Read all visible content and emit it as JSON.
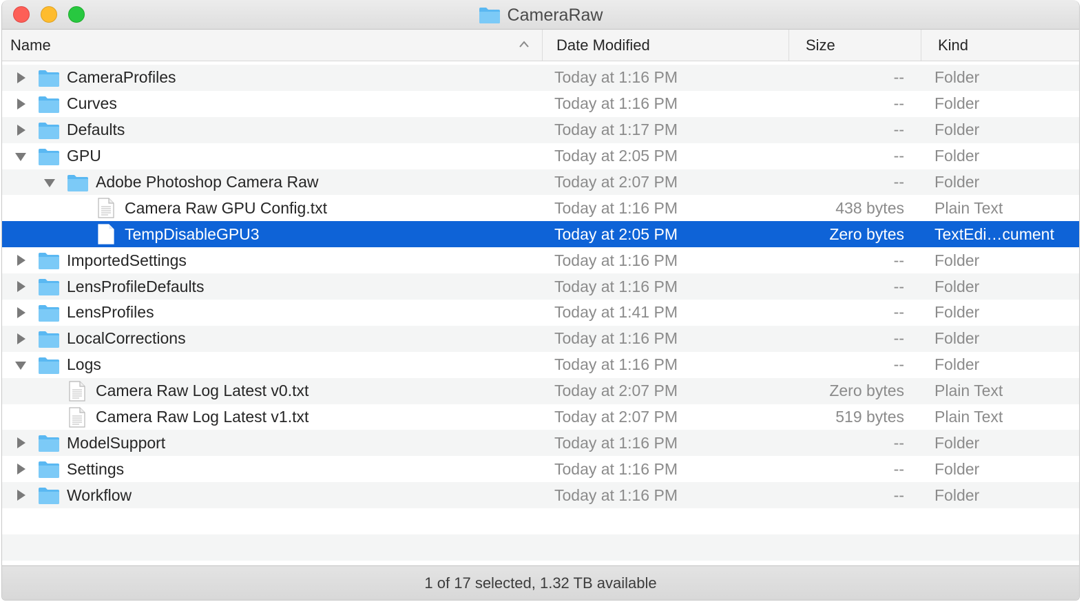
{
  "window": {
    "title": "CameraRaw",
    "title_icon": "folder-icon"
  },
  "columns": {
    "name": "Name",
    "date": "Date Modified",
    "size": "Size",
    "kind": "Kind",
    "sort_indicator": "chevron-up-icon"
  },
  "colors": {
    "selection": "#0e63d7",
    "folder": "#5ab8f2",
    "stripe": "#f4f5f5"
  },
  "rows": [
    {
      "name": "CameraProfiles",
      "date": "Today at 1:16 PM",
      "size": "--",
      "kind": "Folder",
      "type": "folder",
      "depth": 0,
      "disclosure": "collapsed"
    },
    {
      "name": "Curves",
      "date": "Today at 1:16 PM",
      "size": "--",
      "kind": "Folder",
      "type": "folder",
      "depth": 0,
      "disclosure": "collapsed"
    },
    {
      "name": "Defaults",
      "date": "Today at 1:17 PM",
      "size": "--",
      "kind": "Folder",
      "type": "folder",
      "depth": 0,
      "disclosure": "collapsed"
    },
    {
      "name": "GPU",
      "date": "Today at 2:05 PM",
      "size": "--",
      "kind": "Folder",
      "type": "folder",
      "depth": 0,
      "disclosure": "expanded"
    },
    {
      "name": "Adobe Photoshop Camera Raw",
      "date": "Today at 2:07 PM",
      "size": "--",
      "kind": "Folder",
      "type": "folder",
      "depth": 1,
      "disclosure": "expanded"
    },
    {
      "name": "Camera Raw GPU Config.txt",
      "date": "Today at 1:16 PM",
      "size": "438 bytes",
      "kind": "Plain Text",
      "type": "text",
      "depth": 2,
      "disclosure": "none"
    },
    {
      "name": "TempDisableGPU3",
      "date": "Today at 2:05 PM",
      "size": "Zero bytes",
      "kind": "TextEdi…cument",
      "type": "blank",
      "depth": 2,
      "disclosure": "none",
      "selected": true
    },
    {
      "name": "ImportedSettings",
      "date": "Today at 1:16 PM",
      "size": "--",
      "kind": "Folder",
      "type": "folder",
      "depth": 0,
      "disclosure": "collapsed"
    },
    {
      "name": "LensProfileDefaults",
      "date": "Today at 1:16 PM",
      "size": "--",
      "kind": "Folder",
      "type": "folder",
      "depth": 0,
      "disclosure": "collapsed"
    },
    {
      "name": "LensProfiles",
      "date": "Today at 1:41 PM",
      "size": "--",
      "kind": "Folder",
      "type": "folder",
      "depth": 0,
      "disclosure": "collapsed"
    },
    {
      "name": "LocalCorrections",
      "date": "Today at 1:16 PM",
      "size": "--",
      "kind": "Folder",
      "type": "folder",
      "depth": 0,
      "disclosure": "collapsed"
    },
    {
      "name": "Logs",
      "date": "Today at 1:16 PM",
      "size": "--",
      "kind": "Folder",
      "type": "folder",
      "depth": 0,
      "disclosure": "expanded"
    },
    {
      "name": "Camera Raw Log Latest v0.txt",
      "date": "Today at 2:07 PM",
      "size": "Zero bytes",
      "kind": "Plain Text",
      "type": "text",
      "depth": 1,
      "disclosure": "none"
    },
    {
      "name": "Camera Raw Log Latest v1.txt",
      "date": "Today at 2:07 PM",
      "size": "519 bytes",
      "kind": "Plain Text",
      "type": "text",
      "depth": 1,
      "disclosure": "none"
    },
    {
      "name": "ModelSupport",
      "date": "Today at 1:16 PM",
      "size": "--",
      "kind": "Folder",
      "type": "folder",
      "depth": 0,
      "disclosure": "collapsed"
    },
    {
      "name": "Settings",
      "date": "Today at 1:16 PM",
      "size": "--",
      "kind": "Folder",
      "type": "folder",
      "depth": 0,
      "disclosure": "collapsed"
    },
    {
      "name": "Workflow",
      "date": "Today at 1:16 PM",
      "size": "--",
      "kind": "Folder",
      "type": "folder",
      "depth": 0,
      "disclosure": "collapsed"
    }
  ],
  "status": {
    "text": "1 of 17 selected, 1.32 TB available"
  }
}
